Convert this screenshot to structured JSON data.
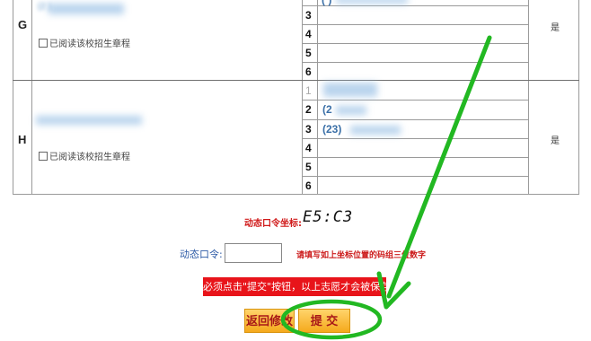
{
  "groups": [
    {
      "letter": "G",
      "blurred_school": "(2   ) ",
      "read_rules_label": "已阅读该校招生章程",
      "answer": "是",
      "rows": [
        "3",
        "4",
        "5",
        "6"
      ],
      "partial_choice": "(  ) "
    },
    {
      "letter": "H",
      "read_rules_label": "已阅读该校招生章程",
      "answer": "是",
      "rows": [
        "1",
        "2",
        "3",
        "4",
        "5",
        "6"
      ],
      "choices": [
        "(2",
        "(23)"
      ]
    }
  ],
  "dynamic_code": {
    "label": "动态口令坐标:",
    "value": "E5:C3"
  },
  "password": {
    "label": "动态口令:",
    "value": "",
    "hint": "请填写如上坐标位置的码组三位数字"
  },
  "notice": "必须点击\"提交\"按钮，以上志愿才会被保存",
  "buttons": {
    "back": "返回修改",
    "submit": "提 交"
  },
  "colors": {
    "annotation": "#22b822",
    "notice_bg": "#e8141a",
    "button_bg": "#f5b53a"
  }
}
